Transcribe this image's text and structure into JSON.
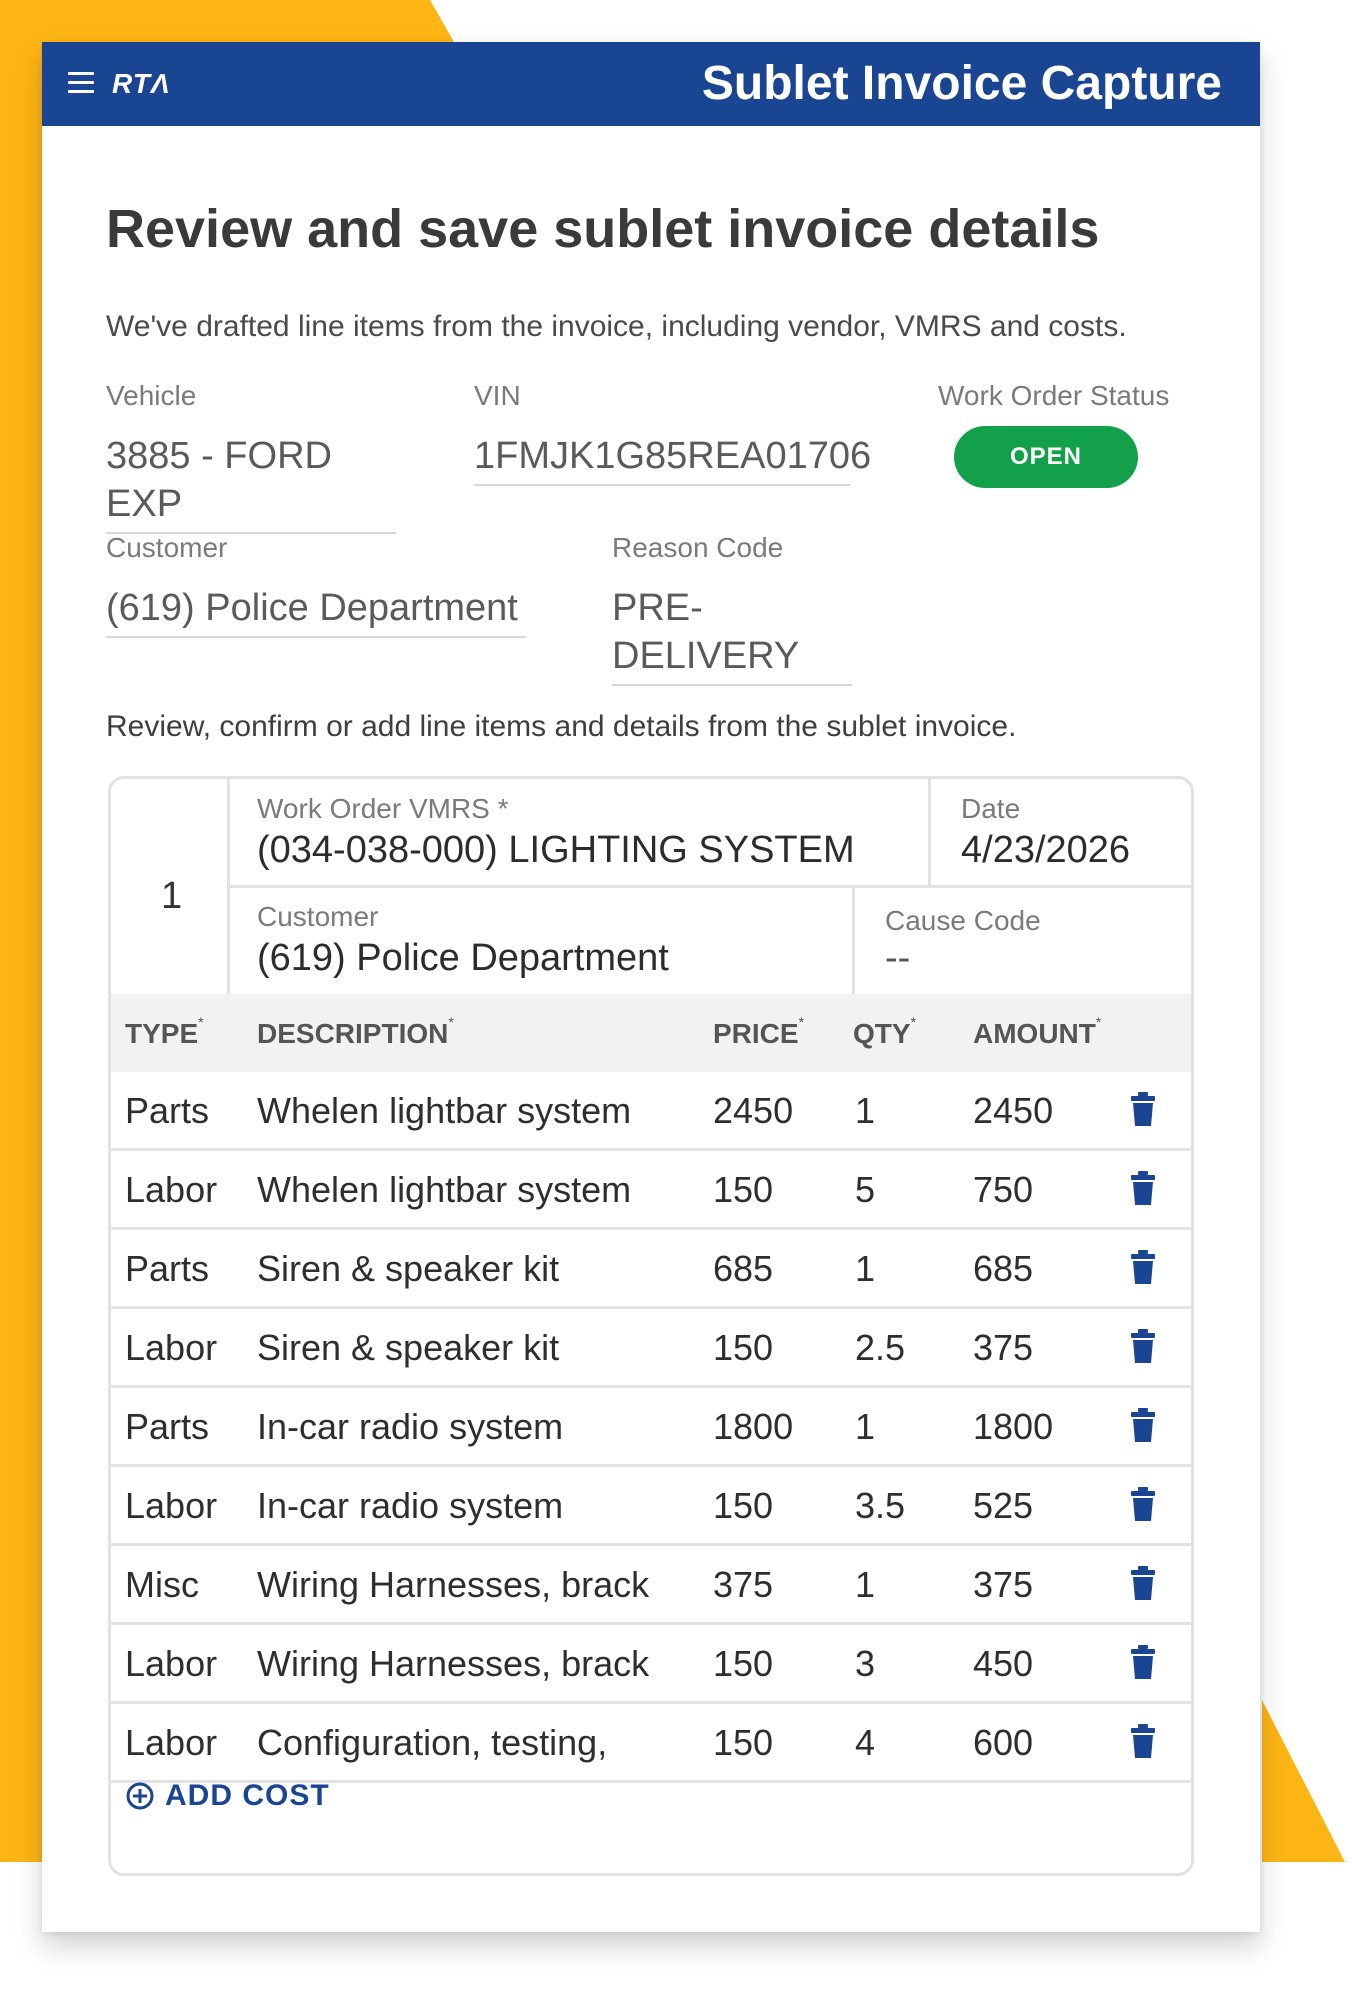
{
  "header": {
    "logo": "RTΛ",
    "app_title": "Sublet Invoice Capture"
  },
  "page": {
    "title": "Review and save sublet invoice details",
    "intro": "We've drafted line items from the invoice, including vendor, VMRS and costs.",
    "review_text": "Review, confirm or add line items and details from the sublet invoice."
  },
  "fields": {
    "vehicle_label": "Vehicle",
    "vehicle_value": "3885 - FORD EXP",
    "vin_label": "VIN",
    "vin_value": "1FMJK1G85REA01706",
    "status_label": "Work Order Status",
    "status_value": "OPEN",
    "customer_label": "Customer",
    "customer_value": "(619) Police Department",
    "reason_label": "Reason Code",
    "reason_value": "PRE-DELIVERY"
  },
  "line_item": {
    "number": "1",
    "vmrs_label": "Work Order VMRS *",
    "vmrs_value": "(034-038-000) LIGHTING SYSTEM",
    "date_label": "Date",
    "date_value": "4/23/2026",
    "customer_label": "Customer",
    "customer_value": "(619) Police Department",
    "cause_label": "Cause Code",
    "cause_value": "--"
  },
  "table": {
    "headers": {
      "type": "TYPE",
      "description": "DESCRIPTION",
      "price": "PRICE",
      "qty": "QTY",
      "amount": "AMOUNT",
      "required_mark": "*"
    },
    "rows": [
      {
        "type": "Parts",
        "description": "Whelen lightbar system",
        "price": "2450",
        "qty": "1",
        "amount": "2450"
      },
      {
        "type": "Labor",
        "description": "Whelen lightbar system",
        "price": "150",
        "qty": "5",
        "amount": "750"
      },
      {
        "type": "Parts",
        "description": "Siren & speaker kit",
        "price": "685",
        "qty": "1",
        "amount": "685"
      },
      {
        "type": "Labor",
        "description": "Siren & speaker kit",
        "price": "150",
        "qty": "2.5",
        "amount": "375"
      },
      {
        "type": "Parts",
        "description": "In-car radio system",
        "price": "1800",
        "qty": "1",
        "amount": "1800"
      },
      {
        "type": "Labor",
        "description": "In-car radio system",
        "price": "150",
        "qty": "3.5",
        "amount": "525"
      },
      {
        "type": "Misc",
        "description": "Wiring Harnesses, brack",
        "price": "375",
        "qty": "1",
        "amount": "375"
      },
      {
        "type": "Labor",
        "description": "Wiring Harnesses, brack",
        "price": "150",
        "qty": "3",
        "amount": "450"
      },
      {
        "type": "Labor",
        "description": "Configuration, testing,",
        "price": "150",
        "qty": "4",
        "amount": "600"
      }
    ],
    "add_cost_label": "ADD COST"
  },
  "colors": {
    "brand_blue": "#1a4592",
    "accent_yellow": "#fdb515",
    "status_green": "#12a14a"
  }
}
